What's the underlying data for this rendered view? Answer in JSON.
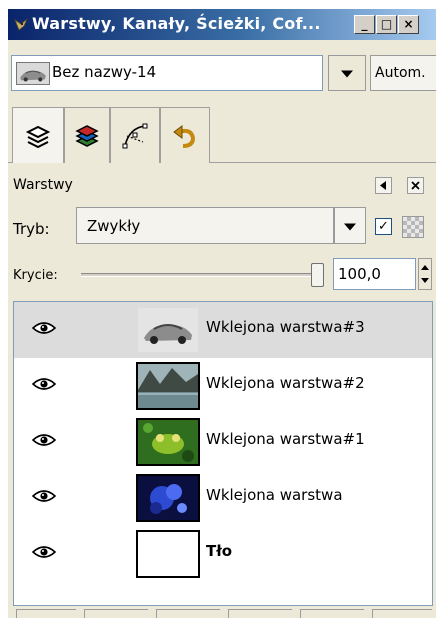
{
  "window": {
    "title": "Warstwy, Kanały, Ścieżki, Cof...",
    "min_glyph": "_",
    "max_glyph": "□",
    "close_glyph": "×",
    "title_icon": "gimp-wilber-icon",
    "title_gradient": [
      "#0a246a",
      "#a6caf0"
    ]
  },
  "image_selector": {
    "name": "Bez nazwy-14",
    "auto_label": "Autom."
  },
  "tabs": [
    {
      "name": "layers-tab",
      "icon": "layers-stack-icon",
      "active": true
    },
    {
      "name": "channels-tab",
      "icon": "channels-icon",
      "active": false
    },
    {
      "name": "paths-tab",
      "icon": "paths-icon",
      "active": false
    },
    {
      "name": "undo-history-tab",
      "icon": "undo-icon",
      "active": false
    }
  ],
  "dock": {
    "title": "Warstwy"
  },
  "mode": {
    "label": "Tryb:",
    "value": "Zwykły",
    "keep_transparency_checked": true,
    "check_glyph": "✓"
  },
  "opacity": {
    "label": "Krycie:",
    "value": "100,0",
    "fraction": 1.0
  },
  "layers": [
    {
      "label": "Wklejona warstwa#3",
      "visible": true,
      "selected": true,
      "thumb": "car"
    },
    {
      "label": "Wklejona warstwa#2",
      "visible": true,
      "selected": false,
      "thumb": "lake"
    },
    {
      "label": "Wklejona warstwa#1",
      "visible": true,
      "selected": false,
      "thumb": "frog"
    },
    {
      "label": "Wklejona warstwa",
      "visible": true,
      "selected": false,
      "thumb": "blue"
    },
    {
      "label": "Tło",
      "visible": true,
      "selected": false,
      "thumb": "white"
    }
  ]
}
